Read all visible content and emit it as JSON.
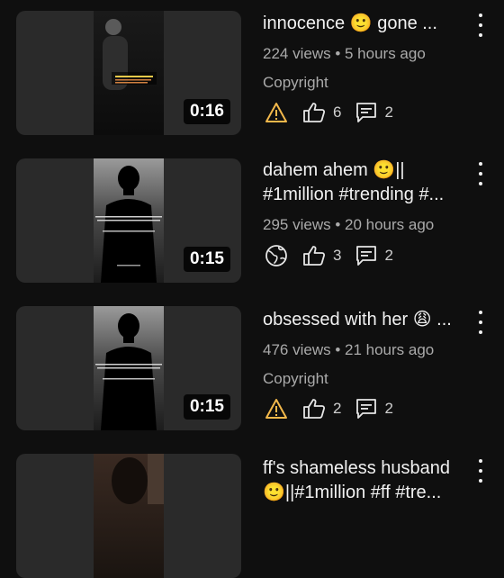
{
  "videos": [
    {
      "title": "innocence 🙂 gone ...",
      "meta": "224 views • 5 hours ago",
      "copyright": "Copyright",
      "duration": "0:16",
      "status_icon": "warning-icon",
      "likes": "6",
      "comments": "2"
    },
    {
      "title": "dahem ahem 🙂|| #1million #trending #...",
      "meta": "295 views • 20 hours ago",
      "copyright": "",
      "duration": "0:15",
      "status_icon": "globe-icon",
      "likes": "3",
      "comments": "2"
    },
    {
      "title": "obsessed with her 😩 ...",
      "meta": "476 views • 21 hours ago",
      "copyright": "Copyright",
      "duration": "0:15",
      "status_icon": "warning-icon",
      "likes": "2",
      "comments": "2"
    },
    {
      "title": "ff's shameless husband 🙂||#1million #ff #tre...",
      "meta": "",
      "copyright": "",
      "duration": "",
      "status_icon": "",
      "likes": "",
      "comments": ""
    }
  ],
  "colors": {
    "background": "#0f0f0f",
    "warning": "#f2b84b",
    "secondary_text": "#aaaaaa"
  }
}
